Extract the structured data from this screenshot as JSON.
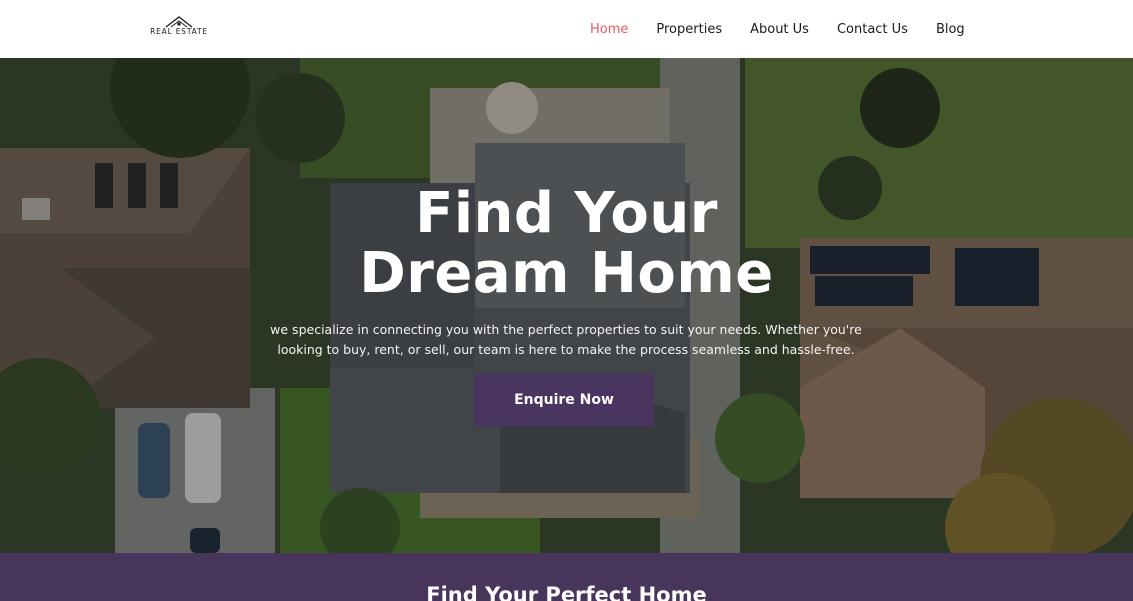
{
  "brand": {
    "logo_text": "REAL ESTATE"
  },
  "nav": {
    "items": [
      {
        "label": "Home",
        "active": true
      },
      {
        "label": "Properties",
        "active": false
      },
      {
        "label": "About Us",
        "active": false
      },
      {
        "label": "Contact Us",
        "active": false
      },
      {
        "label": "Blog",
        "active": false
      }
    ]
  },
  "hero": {
    "title_line1": "Find Your",
    "title_line2": "Dream Home",
    "subtitle": "we specialize in connecting you with the perfect properties to suit your needs. Whether you're looking to buy, rent, or sell, our team is here to make the process seamless and hassle-free.",
    "cta_label": "Enquire Now"
  },
  "section": {
    "title": "Find Your Perfect Home"
  },
  "colors": {
    "accent": "#e85a64",
    "brand_purple": "#4a3560",
    "band_purple": "#47355c",
    "text_dark": "#1a1a1a"
  }
}
